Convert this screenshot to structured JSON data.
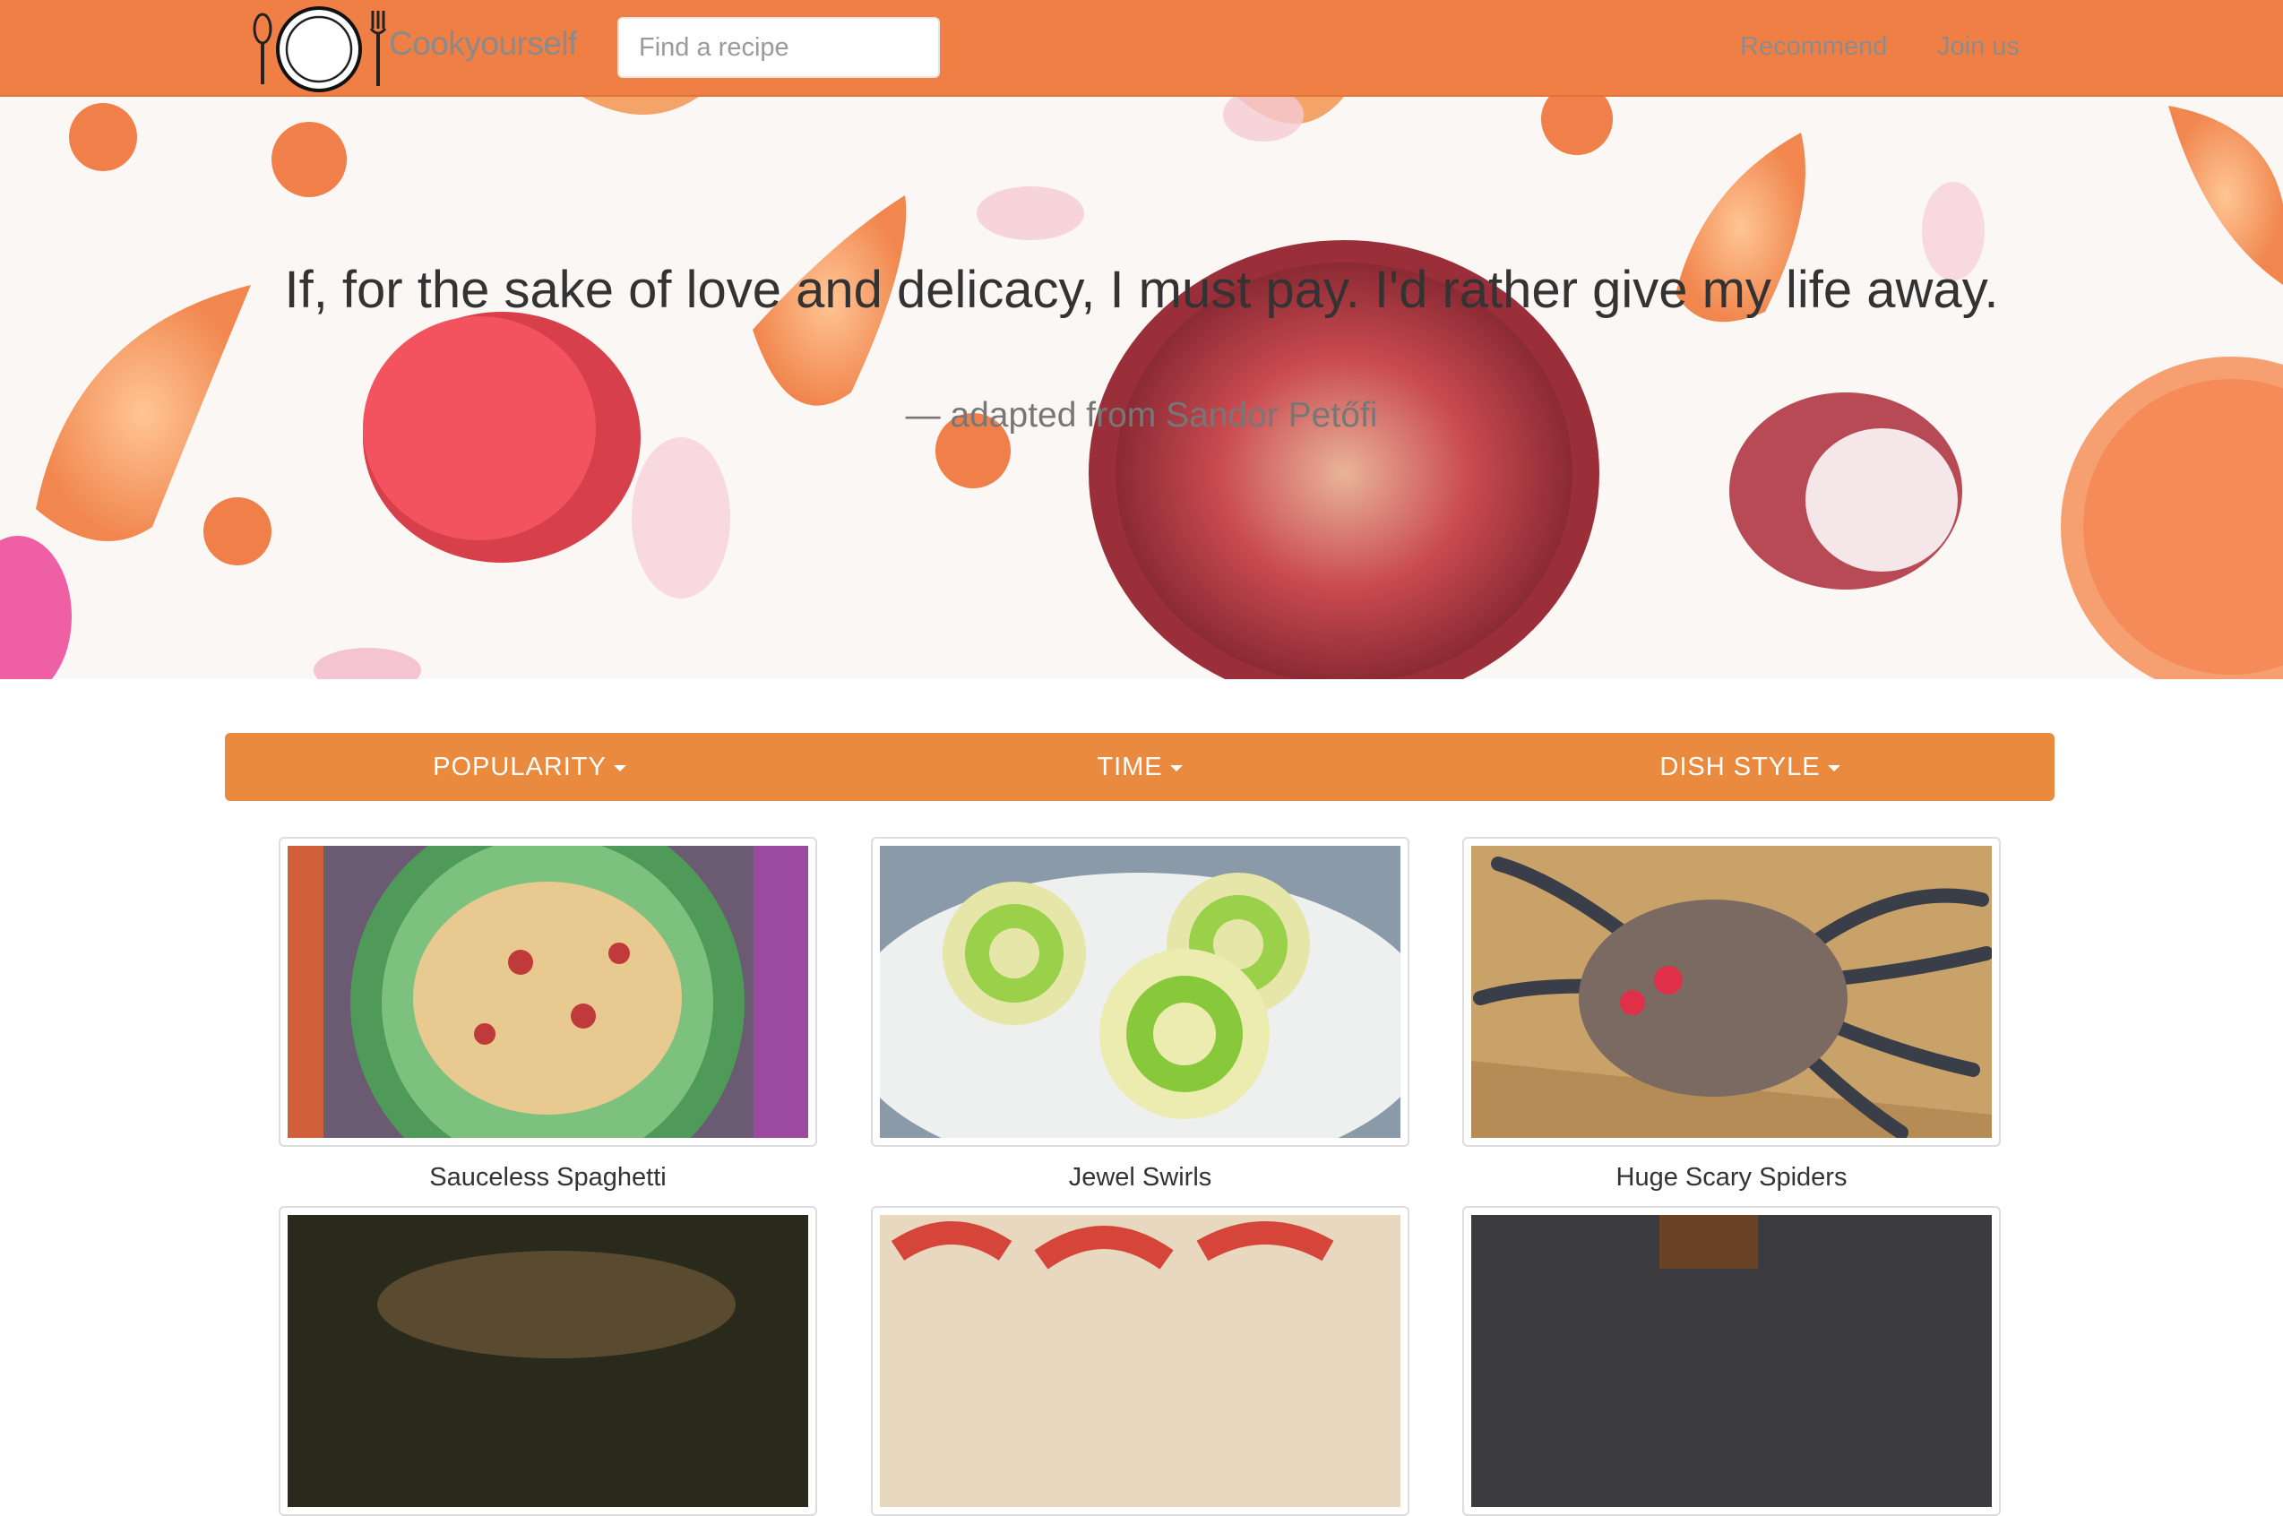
{
  "header": {
    "brand": "Cookyourself",
    "search_placeholder": "Find a recipe",
    "nav": [
      {
        "label": "Recommend"
      },
      {
        "label": "Join us"
      }
    ],
    "logo_icon": "plate-fork-spoon-icon"
  },
  "hero": {
    "quote": "If, for the sake of love and delicacy, I must pay. I'd rather give my life away.",
    "source": "— adapted from Sandor Petőfi"
  },
  "filters": [
    {
      "label": "POPULARITY",
      "icon": "caret-down-icon"
    },
    {
      "label": "TIME",
      "icon": "caret-down-icon"
    },
    {
      "label": "DISH STYLE",
      "icon": "caret-down-icon"
    }
  ],
  "recipes": [
    {
      "title": "Sauceless Spaghetti"
    },
    {
      "title": "Jewel Swirls"
    },
    {
      "title": "Huge Scary Spiders"
    },
    {
      "title": ""
    },
    {
      "title": ""
    },
    {
      "title": ""
    }
  ],
  "colors": {
    "navbar": "#f07f46",
    "filter_bar": "#ea8a3f",
    "text_dark": "#333333"
  }
}
